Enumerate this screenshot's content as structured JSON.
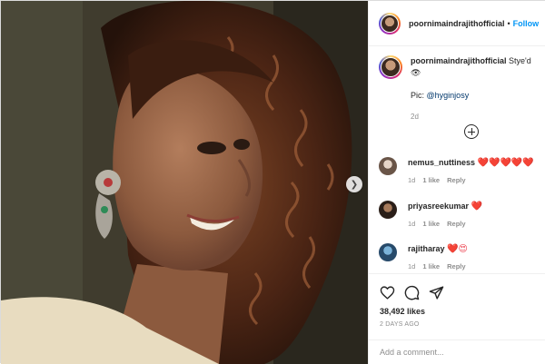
{
  "post": {
    "username": "poornimaindrajithofficial",
    "follow_dot": "•",
    "follow_label": "Follow",
    "caption_text": "Stye'd",
    "caption_emoji": "👁",
    "caption_pic_prefix": "Pic:",
    "caption_mention": "@hyginjosy",
    "caption_time": "2d"
  },
  "comments": [
    {
      "username": "nemus_nuttiness",
      "text": "❤️❤️❤️❤️❤️",
      "time": "1d",
      "likes": "1 like",
      "reply": "Reply"
    },
    {
      "username": "priyasreekumar",
      "text": "❤️",
      "time": "1d",
      "likes": "1 like",
      "reply": "Reply"
    },
    {
      "username": "rajitharay",
      "text": "❤️😍",
      "time": "1d",
      "likes": "1 like",
      "reply": "Reply"
    }
  ],
  "actions": {
    "likes": "38,492 likes",
    "posted": "2 DAYS AGO"
  },
  "add_comment": {
    "placeholder": "Add a comment..."
  },
  "icons": {
    "next": "chevron-right-icon",
    "load_more": "plus-circle-icon",
    "like": "heart-icon",
    "comment": "comment-icon",
    "share": "paper-plane-icon"
  },
  "colors": {
    "link": "#0095f6",
    "mention": "#00376b",
    "heart": "#ed4956",
    "muted": "#8e8e8e"
  }
}
